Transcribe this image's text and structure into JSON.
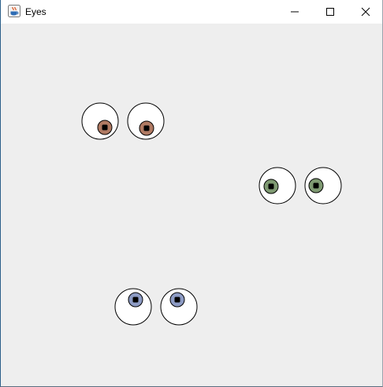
{
  "window": {
    "title": "Eyes",
    "app_icon": "java-cup-icon",
    "controls": {
      "minimize_icon": "minimize-icon",
      "maximize_icon": "maximize-icon",
      "close_icon": "close-icon"
    }
  },
  "canvas": {
    "background": "#eeeeee",
    "eye_stroke": "#000000",
    "pupil_fill": "#000000",
    "sclera_fill": "#ffffff",
    "eye_pairs": [
      {
        "iris_color": "#b07a63"
      },
      {
        "iris_color": "#7f9a72"
      },
      {
        "iris_color": "#8d9bc4"
      }
    ]
  }
}
